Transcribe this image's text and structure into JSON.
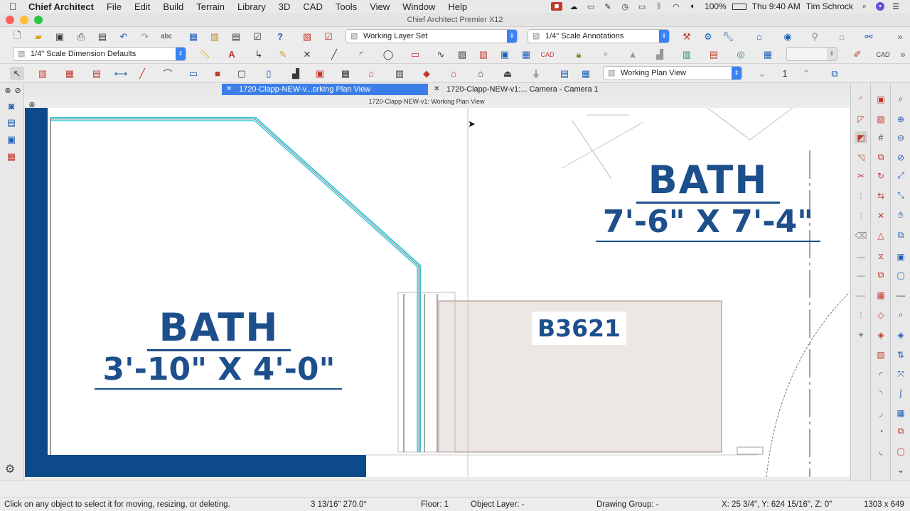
{
  "menubar": {
    "apple": "",
    "items": [
      "Chief Architect",
      "File",
      "Edit",
      "Build",
      "Terrain",
      "Library",
      "3D",
      "CAD",
      "Tools",
      "View",
      "Window",
      "Help"
    ],
    "battery": "100%",
    "clock": "Thu 9:40 AM",
    "user": "Tim Schrock"
  },
  "window": {
    "title": "Chief Architect Premier X12"
  },
  "toolbar1": {
    "layer_set": "Working Layer Set",
    "annotation_set": "1/4\" Scale Annotations"
  },
  "toolbar2": {
    "dimension_defaults": "1/4\" Scale Dimension Defaults"
  },
  "toolbar3": {
    "plan_view": "Working Plan View",
    "floor_number": "1"
  },
  "tabs": [
    {
      "label": "1720-Clapp-NEW-v...orking Plan View",
      "active": true
    },
    {
      "label": "1720-Clapp-NEW-v1:... Camera - Camera 1",
      "active": false
    }
  ],
  "view_subtitle": "1720-Clapp-NEW-v1:  Working Plan View",
  "drawing": {
    "room1": {
      "name": "BATH",
      "size": "3'-10\" X 4'-0\""
    },
    "room2": {
      "name": "BATH",
      "size": "7'-6\" X 7'-4\""
    },
    "cabinet_label": "B3621"
  },
  "status": {
    "hint": "Click on any object to select it for moving, resizing, or deleting.",
    "angle": "3 13/16\"  270.0°",
    "floor": "Floor: 1",
    "object_layer": "Object Layer: -",
    "drawing_group": "Drawing Group: -",
    "coords": "X: 25 3/4\", Y: 624 15/16\", Z: 0\"",
    "window_size": "1303 x 649"
  },
  "colors": {
    "accent": "#3b7ee8",
    "drawing_blue": "#1d4f8c",
    "wall_fill": "#0d4a8a",
    "cyan_line": "#3ec9d6"
  }
}
